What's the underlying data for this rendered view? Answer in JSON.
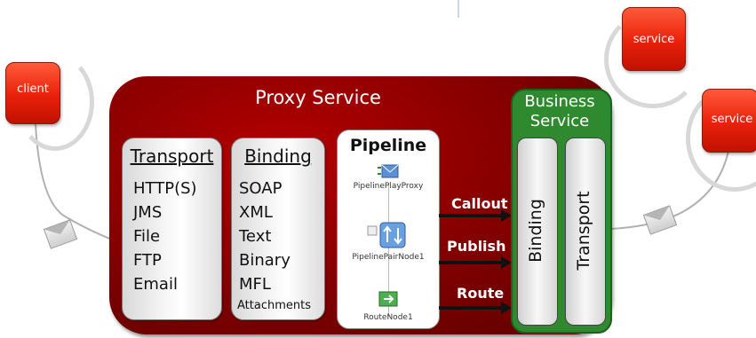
{
  "actors": {
    "client": "client",
    "service_top": "service",
    "service_right": "service"
  },
  "proxy": {
    "title": "Proxy Service",
    "transport": {
      "heading": "Transport",
      "items": [
        "HTTP(S)",
        "JMS",
        "File",
        "FTP",
        "Email"
      ]
    },
    "binding": {
      "heading": "Binding",
      "items": [
        "SOAP",
        "XML",
        "Text",
        "Binary",
        "MFL",
        "Attachments"
      ]
    },
    "pipeline": {
      "heading": "Pipeline",
      "nodes": [
        "PipelinePlayProxy",
        "PipelinePairNode1",
        "RouteNode1"
      ]
    },
    "messages": [
      "Callout",
      "Publish",
      "Route"
    ]
  },
  "business_service": {
    "title_line1": "Business",
    "title_line2": "Service",
    "binding": "Binding",
    "transport": "Transport"
  },
  "colors": {
    "proxy": "#8a0000",
    "business": "#2f8a2f",
    "actor": "#e8200a"
  }
}
